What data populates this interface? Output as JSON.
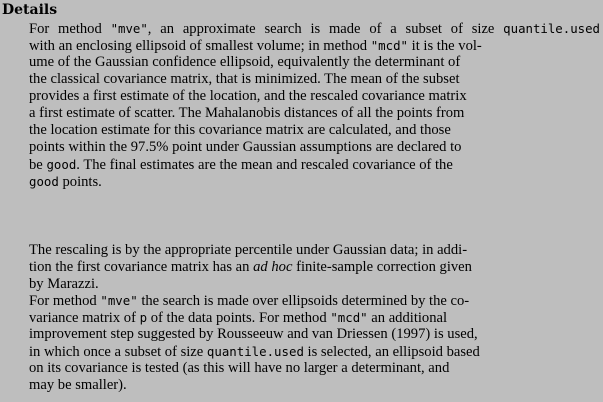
{
  "section": {
    "heading": "Details"
  },
  "paragraphs": [
    {
      "lines": [
        [
          {
            "t": "For method "
          },
          {
            "t": "\"mve\"",
            "m": 1
          },
          {
            "t": ", an approximate search is made of a subset of size "
          },
          {
            "t": "quantile.used",
            "m": 1
          }
        ],
        [
          {
            "t": "with an enclosing ellipsoid of smallest volume; in method "
          },
          {
            "t": "\"mcd\"",
            "m": 1
          },
          {
            "t": " it is the vol-"
          }
        ],
        [
          {
            "t": "ume of the Gaussian confidence ellipsoid, equivalently the determinant of"
          }
        ],
        [
          {
            "t": "the classical covariance matrix, that is minimized. The mean of the subset"
          }
        ],
        [
          {
            "t": "provides a first estimate of the location, and the rescaled covariance matrix"
          }
        ],
        [
          {
            "t": "a first estimate of scatter. The Mahalanobis distances of all the points from"
          }
        ],
        [
          {
            "t": "the location estimate for this covariance matrix are calculated, and those"
          }
        ],
        [
          {
            "t": "points within the 97.5% point under Gaussian assumptions are declared to"
          }
        ],
        [
          {
            "t": "be "
          },
          {
            "t": "good",
            "m": 1
          },
          {
            "t": ". The final estimates are the mean and rescaled covariance of the"
          }
        ],
        [
          {
            "t": "good",
            "m": 1
          },
          {
            "t": " points."
          }
        ]
      ]
    },
    {
      "lines": [
        [
          {
            "t": "The rescaling is by the appropriate percentile under Gaussian data; in addi-"
          }
        ],
        [
          {
            "t": "tion the first covariance matrix has an "
          },
          {
            "t": "ad hoc",
            "i": 1
          },
          {
            "t": " finite-sample correction given"
          }
        ],
        [
          {
            "t": "by Marazzi."
          }
        ]
      ]
    },
    {
      "lines": [
        [
          {
            "t": "For method "
          },
          {
            "t": "\"mve\"",
            "m": 1
          },
          {
            "t": " the search is made over ellipsoids determined by the co-"
          }
        ],
        [
          {
            "t": "variance matrix of "
          },
          {
            "t": "p",
            "m": 1
          },
          {
            "t": " of the data points. For method "
          },
          {
            "t": "\"mcd\"",
            "m": 1
          },
          {
            "t": " an additional"
          }
        ],
        [
          {
            "t": "improvement step suggested by Rousseeuw and van Driessen (1997) is used,"
          }
        ],
        [
          {
            "t": "in which once a subset of size "
          },
          {
            "t": "quantile.used",
            "m": 1
          },
          {
            "t": " is selected, an ellipsoid based"
          }
        ],
        [
          {
            "t": "on its covariance is tested (as this will have no larger a determinant, and"
          }
        ],
        [
          {
            "t": "may be smaller)."
          }
        ]
      ]
    }
  ]
}
